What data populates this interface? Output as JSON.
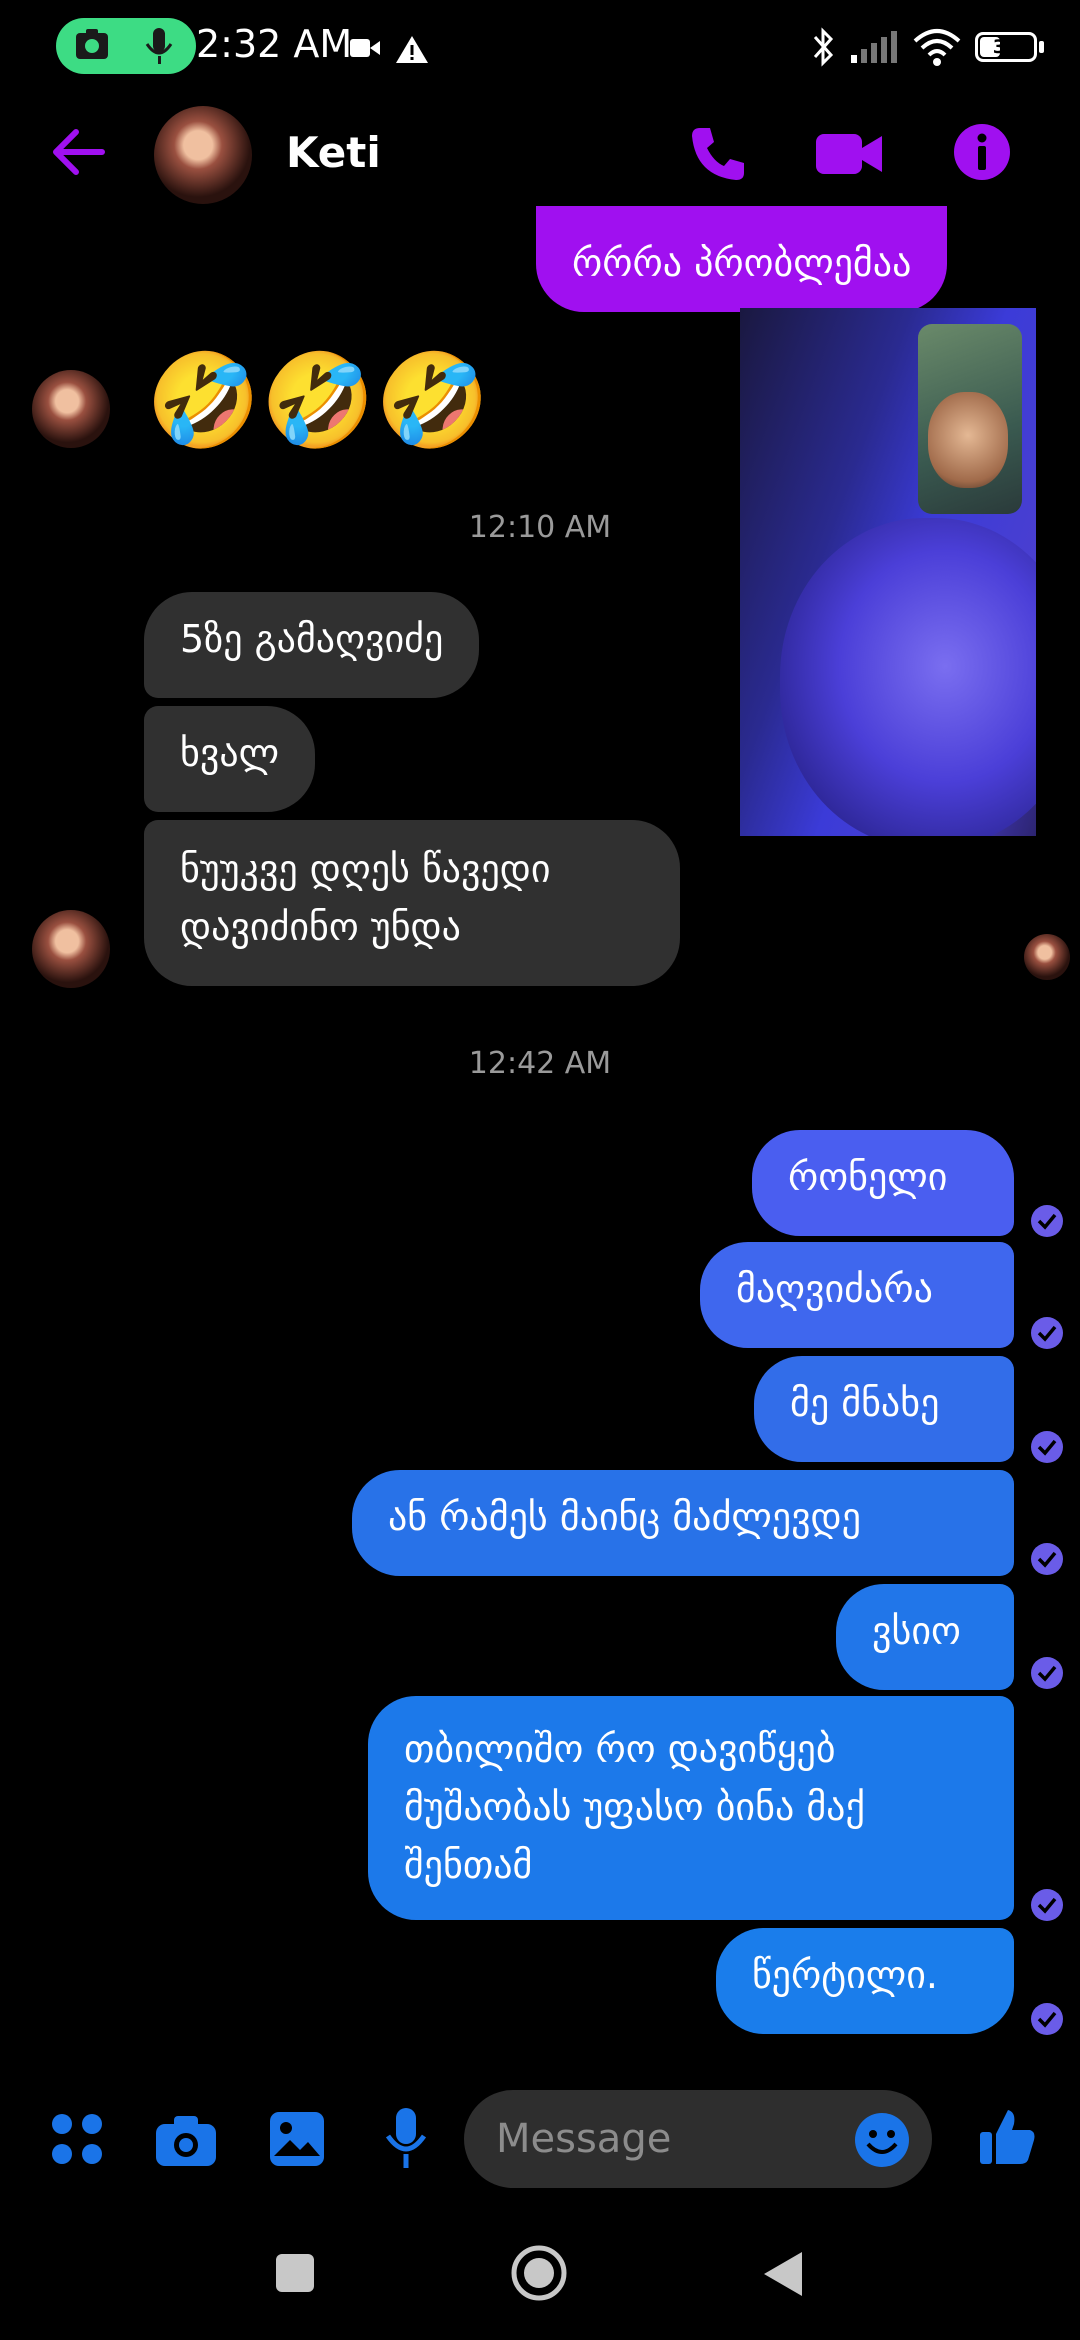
{
  "status": {
    "time": "2:32 AM",
    "battery": "35",
    "battery_level": 0.35,
    "icons": [
      "camera-icon",
      "mic-icon",
      "video-record-icon",
      "warning-icon",
      "bluetooth-icon",
      "signal-icon",
      "wifi-icon",
      "battery-icon"
    ]
  },
  "header": {
    "contact_name": "Keti",
    "icons": [
      "back-arrow-icon",
      "phone-icon",
      "video-camera-icon",
      "info-icon"
    ]
  },
  "colors": {
    "accent": "#a010f0",
    "out_bubble": "#1a74e8",
    "in_bubble": "#303030",
    "video_bg": "#2a2a90"
  },
  "messages": {
    "top_out": "რრრა პრობლემაა",
    "emoji_reaction": "🤣🤣🤣",
    "ts1": "12:10 AM",
    "in1": "5ზე გამაღვიძე",
    "in2": "ხვალ",
    "in3": "ნუუკვე დღეს წავედი\nდავიძინო უნდა",
    "ts2": "12:42 AM",
    "out1": "რონელი",
    "out2": "მაღვიძარა",
    "out3": "მე მნახე",
    "out4": "ან რამეს მაინც მაძლევდე",
    "out5": "ვსიო",
    "out6": "თბილიშო რო დავიწყებ\nმუშაობას უფასო ბინა მაქ\nშენთამ",
    "out7": "წერტილი."
  },
  "composer": {
    "placeholder": "Message",
    "icons": [
      "apps-icon",
      "camera-icon",
      "gallery-icon",
      "mic-icon",
      "emoji-icon",
      "like-icon"
    ]
  },
  "navbar": {
    "icons": [
      "recents-square-icon",
      "home-circle-icon",
      "back-triangle-icon"
    ]
  }
}
